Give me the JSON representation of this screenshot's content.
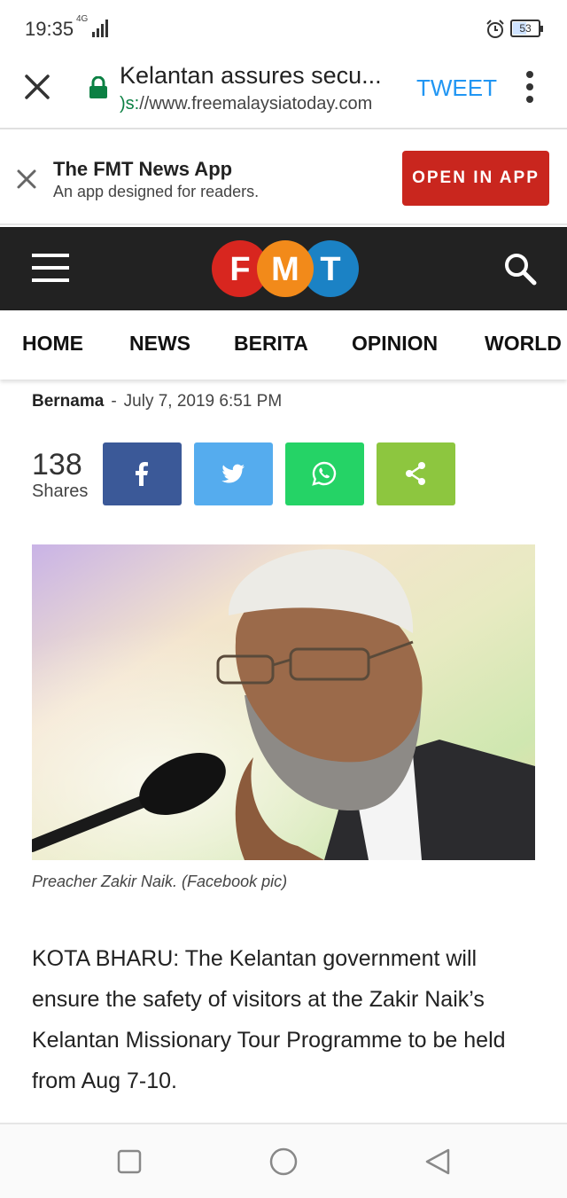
{
  "status_bar": {
    "time": "19:35",
    "network": "4G",
    "battery": "53",
    "battery_level": 0.53
  },
  "tab": {
    "title": "Kelantan assures secu...",
    "url_scheme": ")s:",
    "url_rest": "//www.freemalaysiatoday.com",
    "tweet_label": "TWEET"
  },
  "app_banner": {
    "title": "The FMT News App",
    "subtitle": "An app designed for readers.",
    "open_label": "OPEN IN APP"
  },
  "logo": {
    "letters": [
      "F",
      "M",
      "T"
    ],
    "colors": [
      "#d8261f",
      "#f28a1a",
      "#1b82c5"
    ]
  },
  "nav": {
    "items": [
      "HOME",
      "NEWS",
      "BERITA",
      "OPINION",
      "WORLD"
    ]
  },
  "article": {
    "author": "Bernama",
    "separator": "-",
    "date": "July 7, 2019 6:51 PM",
    "share_count": "138",
    "share_label": "Shares",
    "share_buttons": [
      {
        "icon": "facebook-icon",
        "color": "#3b5998"
      },
      {
        "icon": "twitter-icon",
        "color": "#55acee"
      },
      {
        "icon": "whatsapp-icon",
        "color": "#25d366"
      },
      {
        "icon": "share-icon",
        "color": "#8dc63f"
      }
    ],
    "caption": "Preacher Zakir Naik. (Facebook pic)",
    "body": "KOTA BHARU: The Kelantan government will ensure the safety of visitors at the Zakir Naik’s Kelantan Missionary Tour Programme to be held from Aug 7-10."
  }
}
